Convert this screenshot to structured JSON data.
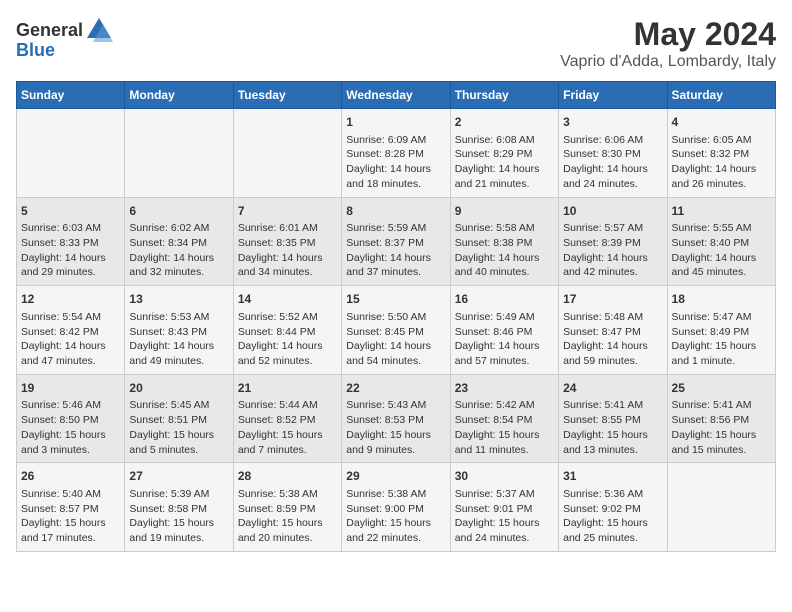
{
  "header": {
    "logo_general": "General",
    "logo_blue": "Blue",
    "title": "May 2024",
    "subtitle": "Vaprio d'Adda, Lombardy, Italy"
  },
  "days_of_week": [
    "Sunday",
    "Monday",
    "Tuesday",
    "Wednesday",
    "Thursday",
    "Friday",
    "Saturday"
  ],
  "weeks": [
    [
      {
        "day": "",
        "info": ""
      },
      {
        "day": "",
        "info": ""
      },
      {
        "day": "",
        "info": ""
      },
      {
        "day": "1",
        "info": "Sunrise: 6:09 AM\nSunset: 8:28 PM\nDaylight: 14 hours\nand 18 minutes."
      },
      {
        "day": "2",
        "info": "Sunrise: 6:08 AM\nSunset: 8:29 PM\nDaylight: 14 hours\nand 21 minutes."
      },
      {
        "day": "3",
        "info": "Sunrise: 6:06 AM\nSunset: 8:30 PM\nDaylight: 14 hours\nand 24 minutes."
      },
      {
        "day": "4",
        "info": "Sunrise: 6:05 AM\nSunset: 8:32 PM\nDaylight: 14 hours\nand 26 minutes."
      }
    ],
    [
      {
        "day": "5",
        "info": "Sunrise: 6:03 AM\nSunset: 8:33 PM\nDaylight: 14 hours\nand 29 minutes."
      },
      {
        "day": "6",
        "info": "Sunrise: 6:02 AM\nSunset: 8:34 PM\nDaylight: 14 hours\nand 32 minutes."
      },
      {
        "day": "7",
        "info": "Sunrise: 6:01 AM\nSunset: 8:35 PM\nDaylight: 14 hours\nand 34 minutes."
      },
      {
        "day": "8",
        "info": "Sunrise: 5:59 AM\nSunset: 8:37 PM\nDaylight: 14 hours\nand 37 minutes."
      },
      {
        "day": "9",
        "info": "Sunrise: 5:58 AM\nSunset: 8:38 PM\nDaylight: 14 hours\nand 40 minutes."
      },
      {
        "day": "10",
        "info": "Sunrise: 5:57 AM\nSunset: 8:39 PM\nDaylight: 14 hours\nand 42 minutes."
      },
      {
        "day": "11",
        "info": "Sunrise: 5:55 AM\nSunset: 8:40 PM\nDaylight: 14 hours\nand 45 minutes."
      }
    ],
    [
      {
        "day": "12",
        "info": "Sunrise: 5:54 AM\nSunset: 8:42 PM\nDaylight: 14 hours\nand 47 minutes."
      },
      {
        "day": "13",
        "info": "Sunrise: 5:53 AM\nSunset: 8:43 PM\nDaylight: 14 hours\nand 49 minutes."
      },
      {
        "day": "14",
        "info": "Sunrise: 5:52 AM\nSunset: 8:44 PM\nDaylight: 14 hours\nand 52 minutes."
      },
      {
        "day": "15",
        "info": "Sunrise: 5:50 AM\nSunset: 8:45 PM\nDaylight: 14 hours\nand 54 minutes."
      },
      {
        "day": "16",
        "info": "Sunrise: 5:49 AM\nSunset: 8:46 PM\nDaylight: 14 hours\nand 57 minutes."
      },
      {
        "day": "17",
        "info": "Sunrise: 5:48 AM\nSunset: 8:47 PM\nDaylight: 14 hours\nand 59 minutes."
      },
      {
        "day": "18",
        "info": "Sunrise: 5:47 AM\nSunset: 8:49 PM\nDaylight: 15 hours\nand 1 minute."
      }
    ],
    [
      {
        "day": "19",
        "info": "Sunrise: 5:46 AM\nSunset: 8:50 PM\nDaylight: 15 hours\nand 3 minutes."
      },
      {
        "day": "20",
        "info": "Sunrise: 5:45 AM\nSunset: 8:51 PM\nDaylight: 15 hours\nand 5 minutes."
      },
      {
        "day": "21",
        "info": "Sunrise: 5:44 AM\nSunset: 8:52 PM\nDaylight: 15 hours\nand 7 minutes."
      },
      {
        "day": "22",
        "info": "Sunrise: 5:43 AM\nSunset: 8:53 PM\nDaylight: 15 hours\nand 9 minutes."
      },
      {
        "day": "23",
        "info": "Sunrise: 5:42 AM\nSunset: 8:54 PM\nDaylight: 15 hours\nand 11 minutes."
      },
      {
        "day": "24",
        "info": "Sunrise: 5:41 AM\nSunset: 8:55 PM\nDaylight: 15 hours\nand 13 minutes."
      },
      {
        "day": "25",
        "info": "Sunrise: 5:41 AM\nSunset: 8:56 PM\nDaylight: 15 hours\nand 15 minutes."
      }
    ],
    [
      {
        "day": "26",
        "info": "Sunrise: 5:40 AM\nSunset: 8:57 PM\nDaylight: 15 hours\nand 17 minutes."
      },
      {
        "day": "27",
        "info": "Sunrise: 5:39 AM\nSunset: 8:58 PM\nDaylight: 15 hours\nand 19 minutes."
      },
      {
        "day": "28",
        "info": "Sunrise: 5:38 AM\nSunset: 8:59 PM\nDaylight: 15 hours\nand 20 minutes."
      },
      {
        "day": "29",
        "info": "Sunrise: 5:38 AM\nSunset: 9:00 PM\nDaylight: 15 hours\nand 22 minutes."
      },
      {
        "day": "30",
        "info": "Sunrise: 5:37 AM\nSunset: 9:01 PM\nDaylight: 15 hours\nand 24 minutes."
      },
      {
        "day": "31",
        "info": "Sunrise: 5:36 AM\nSunset: 9:02 PM\nDaylight: 15 hours\nand 25 minutes."
      },
      {
        "day": "",
        "info": ""
      }
    ]
  ]
}
